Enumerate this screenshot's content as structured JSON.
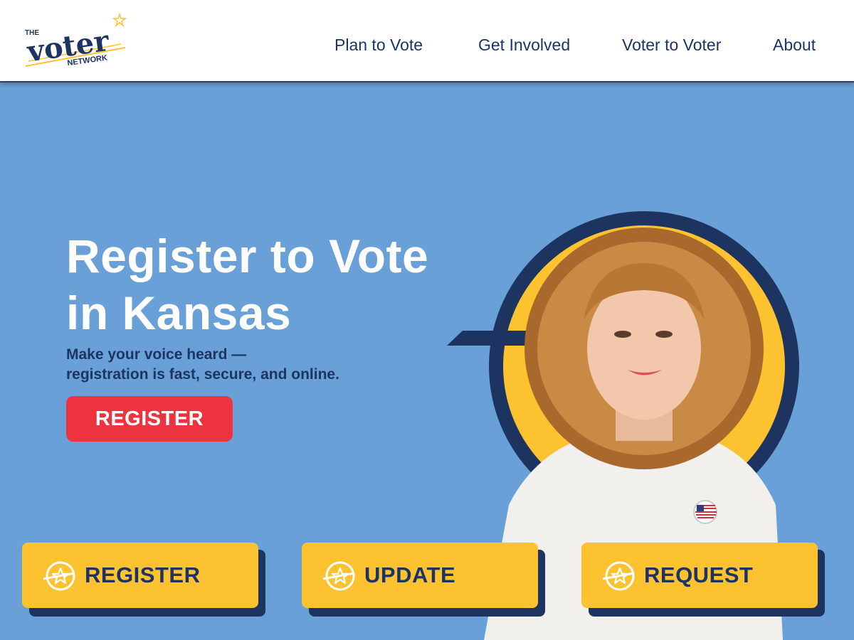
{
  "brand": {
    "the": "THE",
    "voter": "voter",
    "network": "NETWORK"
  },
  "nav": [
    "Plan to Vote",
    "Get Involved",
    "Voter to Voter",
    "About"
  ],
  "hero": {
    "title_line1": "Register to Vote",
    "title_line2": "in Kansas",
    "subtitle_line1": "Make your voice heard —",
    "subtitle_line2": "registration is fast, secure, and online.",
    "cta": "REGISTER"
  },
  "cards": [
    {
      "label": "REGISTER",
      "icon": "star-circle-icon"
    },
    {
      "label": "UPDATE",
      "icon": "star-circle-icon"
    },
    {
      "label": "REQUEST",
      "icon": "star-circle-icon"
    }
  ],
  "colors": {
    "background": "#6aa0d8",
    "navy": "#1d3461",
    "yellow": "#fdc230",
    "cta_red": "#ee3340",
    "white": "#ffffff"
  }
}
